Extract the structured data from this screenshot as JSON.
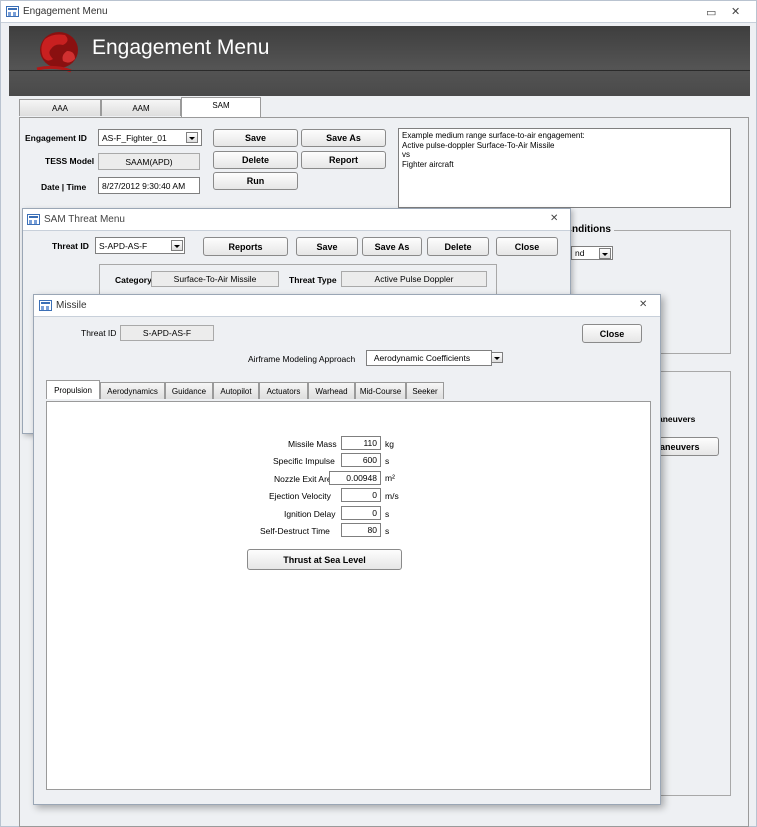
{
  "main_window": {
    "title": "Engagement Menu",
    "header_title": "Engagement Menu",
    "tabs": [
      "AAA",
      "AAM",
      "SAM"
    ],
    "engagement_id_label": "Engagement ID",
    "engagement_id_value": "AS-F_Fighter_01",
    "tess_model_label": "TESS Model",
    "tess_model_value": "SAAM(APD)",
    "date_time_label": "Date | Time",
    "date_time_value": "8/27/2012 9:30:40 AM",
    "buttons": {
      "save": "Save",
      "save_as": "Save As",
      "delete": "Delete",
      "report": "Report",
      "run": "Run"
    },
    "description": [
      "Example medium range surface-to-air engagement:",
      "Active pulse-doppler Surface-To-Air Missile",
      "vs",
      "Fighter aircraft"
    ],
    "conditions_fragment": "nditions",
    "cond_value_fragment": "nd",
    "maneuvers_label_fragment": "aneuvers",
    "maneuvers_button_fragment": "aneuvers"
  },
  "sam_window": {
    "title": "SAM Threat Menu",
    "threat_id_label": "Threat ID",
    "threat_id_value": "S-APD-AS-F",
    "buttons": {
      "reports": "Reports",
      "save": "Save",
      "save_as": "Save As",
      "delete": "Delete",
      "close": "Close"
    },
    "category_label": "Category",
    "category_value": "Surface-To-Air Missile",
    "threat_type_label": "Threat Type",
    "threat_type_value": "Active Pulse Doppler"
  },
  "missile_window": {
    "title": "Missile",
    "threat_id_label": "Threat ID",
    "threat_id_value": "S-APD-AS-F",
    "close_label": "Close",
    "airframe_label": "Airframe Modeling Approach",
    "airframe_value": "Aerodynamic Coefficients",
    "tabs": [
      "Propulsion",
      "Aerodynamics",
      "Guidance",
      "Autopilot",
      "Actuators",
      "Warhead",
      "Mid-Course",
      "Seeker"
    ],
    "fields": [
      {
        "label": "Missile Mass",
        "value": "110",
        "unit": "kg"
      },
      {
        "label": "Specific Impulse",
        "value": "600",
        "unit": "s"
      },
      {
        "label": "Nozzle Exit Area",
        "value": "0.00948",
        "unit": "m²"
      },
      {
        "label": "Ejection Velocity",
        "value": "0",
        "unit": "m/s"
      },
      {
        "label": "Ignition Delay",
        "value": "0",
        "unit": "s"
      },
      {
        "label": "Self-Destruct Time",
        "value": "80",
        "unit": "s"
      }
    ],
    "thrust_button": "Thrust at Sea Level"
  }
}
